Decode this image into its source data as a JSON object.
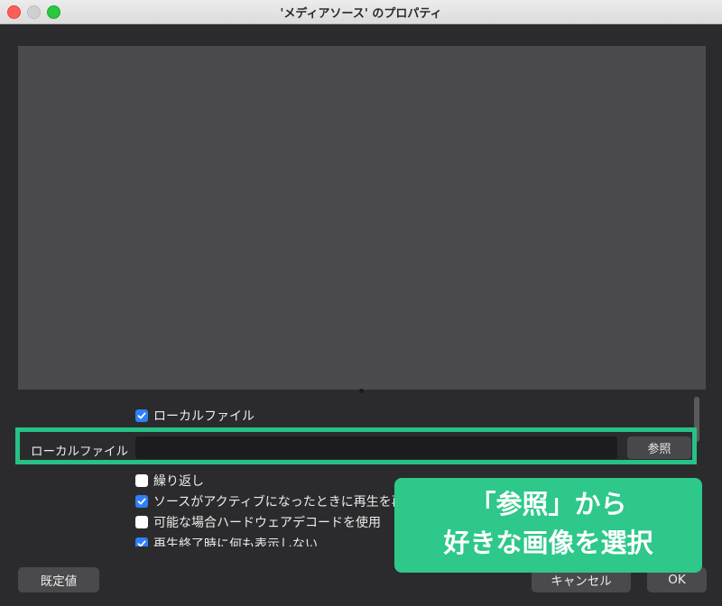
{
  "window": {
    "title": "'メディアソース' のプロパティ",
    "controls": {
      "close_color": "#ff5f57",
      "minimize_color": "#d0d0d0",
      "zoom_color": "#28c840"
    }
  },
  "properties": {
    "local_file_checkbox": {
      "label": "ローカルファイル",
      "checked": true
    },
    "local_file_field": {
      "label": "ローカルファイル",
      "value": "",
      "browse_label": "参照"
    },
    "options": [
      {
        "label": "繰り返し",
        "checked": false
      },
      {
        "label": "ソースがアクティブになったときに再生を再",
        "checked": true
      },
      {
        "label": "可能な場合ハードウェアデコードを使用",
        "checked": false
      },
      {
        "label": "再生終了時に何も表示しない",
        "checked": true
      }
    ]
  },
  "footer": {
    "defaults_label": "既定値",
    "cancel_label": "キャンセル",
    "ok_label": "OK"
  },
  "annotation": {
    "line1": "「参照」から",
    "line2": "好きな画像を選択",
    "color": "#2dc88a"
  },
  "colors": {
    "highlight_border": "#27c187",
    "checkbox_accent": "#2f7ff6"
  }
}
